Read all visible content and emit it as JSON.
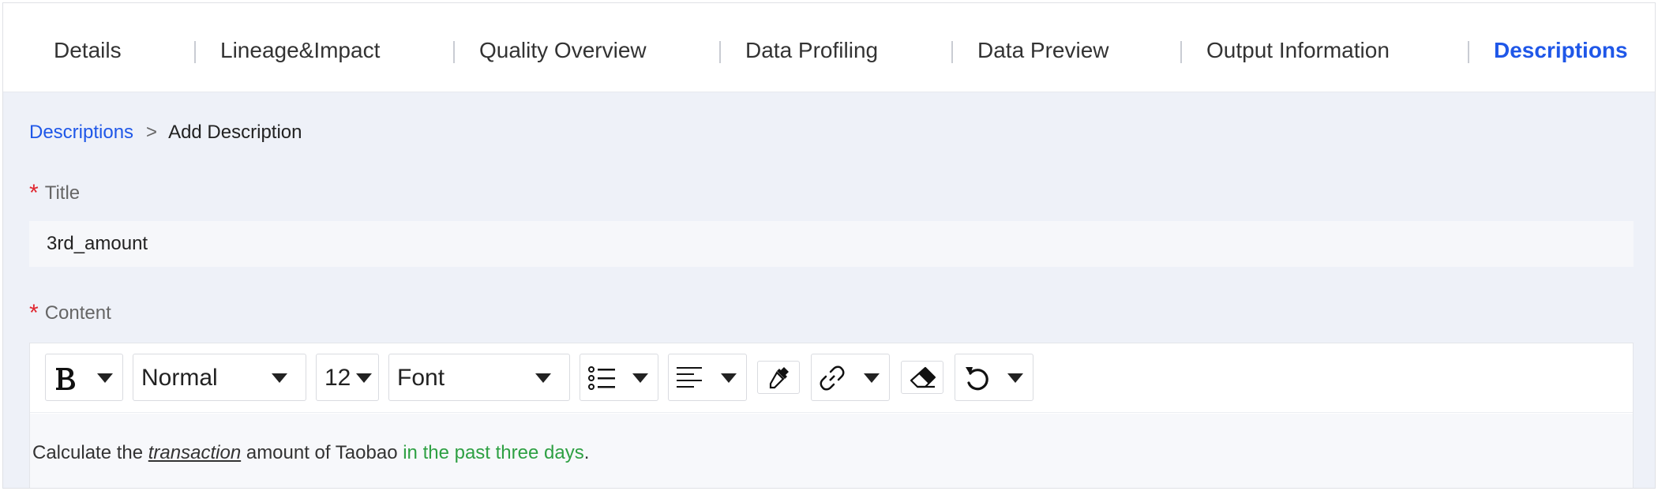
{
  "tabs": [
    {
      "label": "Details",
      "active": false
    },
    {
      "label": "Lineage&Impact",
      "active": false
    },
    {
      "label": "Quality Overview",
      "active": false
    },
    {
      "label": "Data Profiling",
      "active": false
    },
    {
      "label": "Data Preview",
      "active": false
    },
    {
      "label": "Output Information",
      "active": false
    },
    {
      "label": "Descriptions",
      "active": true
    }
  ],
  "breadcrumb": {
    "parent": "Descriptions",
    "separator": ">",
    "current": "Add Description"
  },
  "form": {
    "title_label": "Title",
    "title_value": "3rd_amount",
    "content_label": "Content",
    "required_mark": "*"
  },
  "toolbar": {
    "bold_icon": "bold-icon",
    "paragraph_style": "Normal",
    "font_size": "12",
    "font_family": "Font",
    "list_icon": "bulleted-list-icon",
    "align_icon": "align-left-icon",
    "color_icon": "color-picker-icon",
    "link_icon": "link-icon",
    "clear_icon": "eraser-icon",
    "undo_icon": "undo-icon"
  },
  "content": {
    "part1": "Calculate the ",
    "part2_italic_underlined": "transaction",
    "part3": " amount of Taobao ",
    "part4_green": "in the past three days",
    "part5": "."
  },
  "colors": {
    "accent": "#1f57e8",
    "required": "#e0262f",
    "highlight_text": "#2ea043",
    "panel_bg": "#eef1f8"
  }
}
